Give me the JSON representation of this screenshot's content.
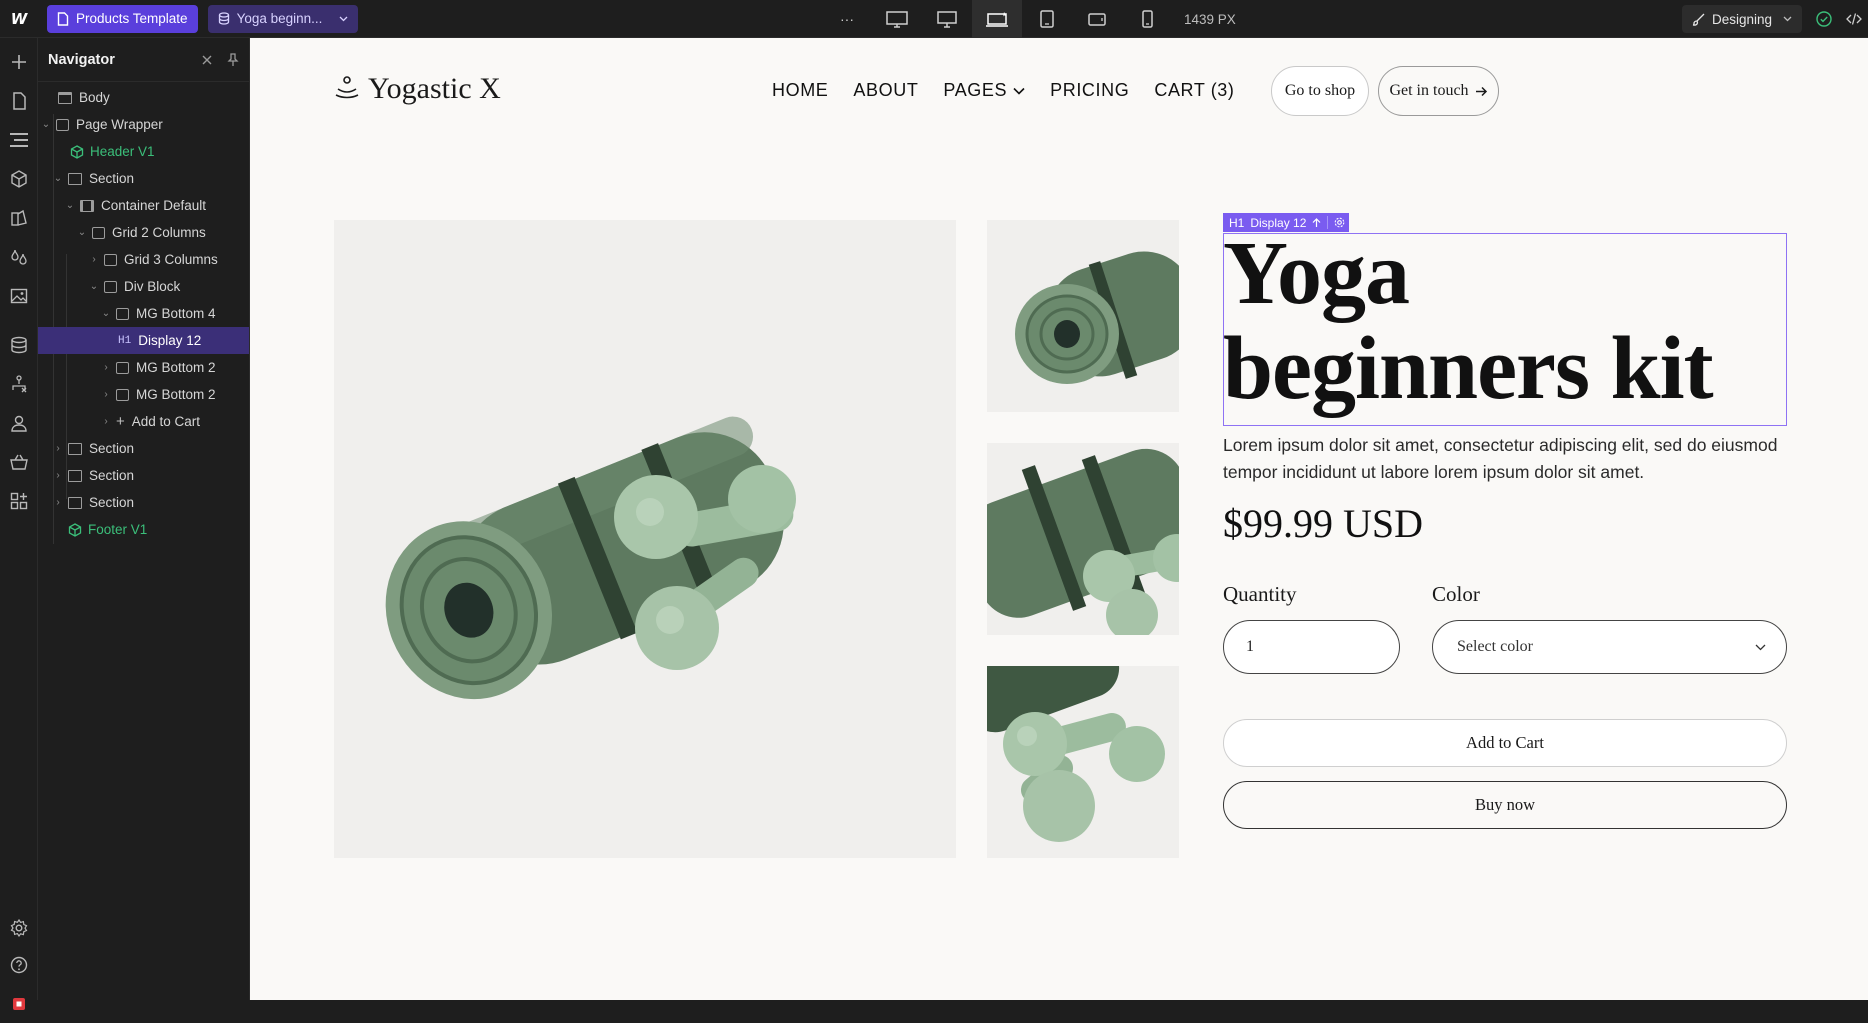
{
  "toolbar": {
    "logo": "W",
    "page_button": "Products Template",
    "cms_item": "Yoga beginn...",
    "more": "···",
    "width_readout": "1439 PX",
    "mode_label": "Designing"
  },
  "navigator": {
    "title": "Navigator",
    "items": [
      {
        "label": "Body"
      },
      {
        "label": "Page Wrapper"
      },
      {
        "label": "Header V1"
      },
      {
        "label": "Section"
      },
      {
        "label": "Container Default"
      },
      {
        "label": "Grid 2 Columns"
      },
      {
        "label": "Grid 3 Columns"
      },
      {
        "label": "Div Block"
      },
      {
        "label": "MG Bottom 4"
      },
      {
        "label": "Display 12",
        "tag": "H1"
      },
      {
        "label": "MG Bottom 2"
      },
      {
        "label": "MG Bottom 2"
      },
      {
        "label": "Add to Cart"
      },
      {
        "label": "Section"
      },
      {
        "label": "Section"
      },
      {
        "label": "Section"
      },
      {
        "label": "Footer V1"
      }
    ]
  },
  "site": {
    "logo_text": "Yogastic X",
    "menu": [
      "HOME",
      "ABOUT",
      "PAGES",
      "PRICING",
      "CART (3)"
    ],
    "shop_button": "Go to shop",
    "contact_button": "Get in touch"
  },
  "product": {
    "selection_tag": "H1",
    "selection_label": "Display 12",
    "title_line1": "Yoga",
    "title_line2": "beginners kit",
    "description": "Lorem ipsum dolor sit amet, consectetur adipiscing elit, sed do eiusmod tempor incididunt ut labore lorem ipsum dolor sit amet.",
    "price": "$99.99 USD",
    "quantity_label": "Quantity",
    "quantity_value": "1",
    "color_label": "Color",
    "color_placeholder": "Select color",
    "add_to_cart": "Add to Cart",
    "buy_now": "Buy now"
  },
  "colors": {
    "accent": "#5a3fdc",
    "selection": "#8e72f4",
    "symbol_green": "#3bbf7a",
    "mat_green": "#56705a",
    "dumbbell_green": "#a7c3a8"
  }
}
